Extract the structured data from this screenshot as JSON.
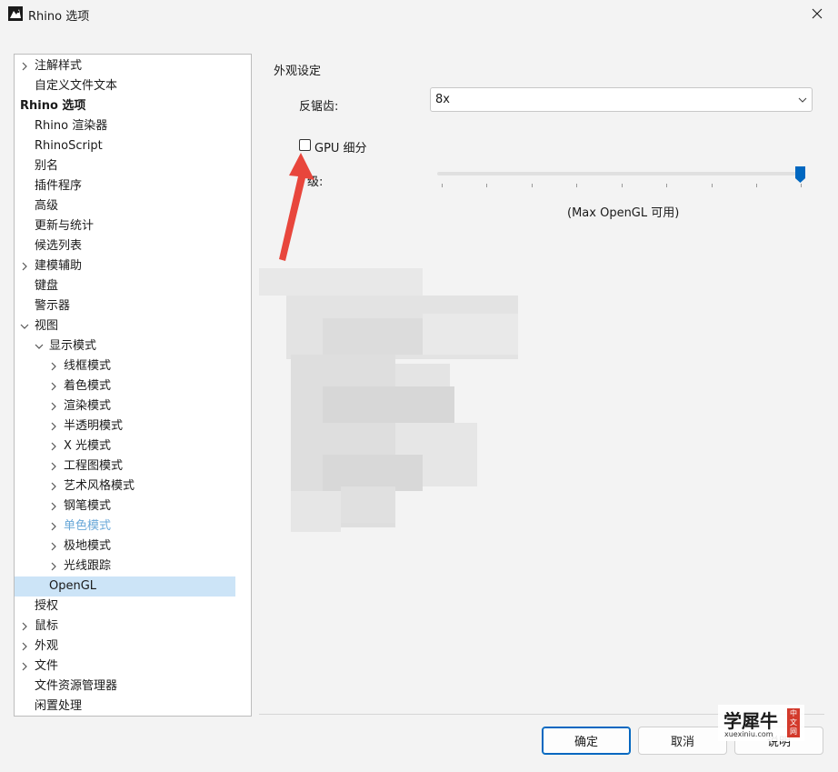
{
  "window": {
    "title": "Rhino 选项",
    "close_icon": "close-icon"
  },
  "tree": {
    "items": [
      {
        "label": "注解样式",
        "chevron": "right"
      },
      {
        "label": "自定义文件文本",
        "chevron": ""
      },
      {
        "label": "Rhino 选项",
        "chevron": "",
        "bold": true
      },
      {
        "label": "Rhino 渲染器",
        "chevron": ""
      },
      {
        "label": "RhinoScript",
        "chevron": ""
      },
      {
        "label": "别名",
        "chevron": ""
      },
      {
        "label": "插件程序",
        "chevron": ""
      },
      {
        "label": "高级",
        "chevron": ""
      },
      {
        "label": "更新与统计",
        "chevron": ""
      },
      {
        "label": "候选列表",
        "chevron": ""
      },
      {
        "label": "建模辅助",
        "chevron": "right"
      },
      {
        "label": "键盘",
        "chevron": ""
      },
      {
        "label": "警示器",
        "chevron": ""
      },
      {
        "label": "视图",
        "chevron": "down"
      },
      {
        "label": "显示模式",
        "chevron": "down"
      },
      {
        "label": "线框模式",
        "chevron": "right"
      },
      {
        "label": "着色模式",
        "chevron": "right"
      },
      {
        "label": "渲染模式",
        "chevron": "right"
      },
      {
        "label": "半透明模式",
        "chevron": "right"
      },
      {
        "label": "X 光模式",
        "chevron": "right"
      },
      {
        "label": "工程图模式",
        "chevron": "right"
      },
      {
        "label": "艺术风格模式",
        "chevron": "right"
      },
      {
        "label": "钢笔模式",
        "chevron": "right"
      },
      {
        "label": "单色模式",
        "chevron": "right",
        "dim": true
      },
      {
        "label": "极地模式",
        "chevron": "right"
      },
      {
        "label": "光线跟踪",
        "chevron": "right"
      },
      {
        "label": "OpenGL",
        "chevron": "",
        "selected": true
      },
      {
        "label": "授权",
        "chevron": ""
      },
      {
        "label": "鼠标",
        "chevron": "right"
      },
      {
        "label": "外观",
        "chevron": "right"
      },
      {
        "label": "文件",
        "chevron": "right"
      },
      {
        "label": "文件资源管理器",
        "chevron": ""
      },
      {
        "label": "闲置处理",
        "chevron": ""
      }
    ]
  },
  "appearance": {
    "section_title": "外观设定",
    "antialias_label": "反锯齿:",
    "antialias_value": "8x",
    "gpu_label": "GPU 细分",
    "gpu_checked": false,
    "level_label": "级:",
    "level_fraction": 1.0,
    "max_note": "(Max OpenGL 可用)"
  },
  "buttons": {
    "ok": "确定",
    "cancel": "取消",
    "help": "说明"
  },
  "watermark": {
    "main": "学犀牛",
    "sub": "xuexiniu.com",
    "seal": "中文网"
  },
  "colors": {
    "selection": "#cce4f7",
    "accent": "#0067c0",
    "arrow": "#e8463c"
  }
}
